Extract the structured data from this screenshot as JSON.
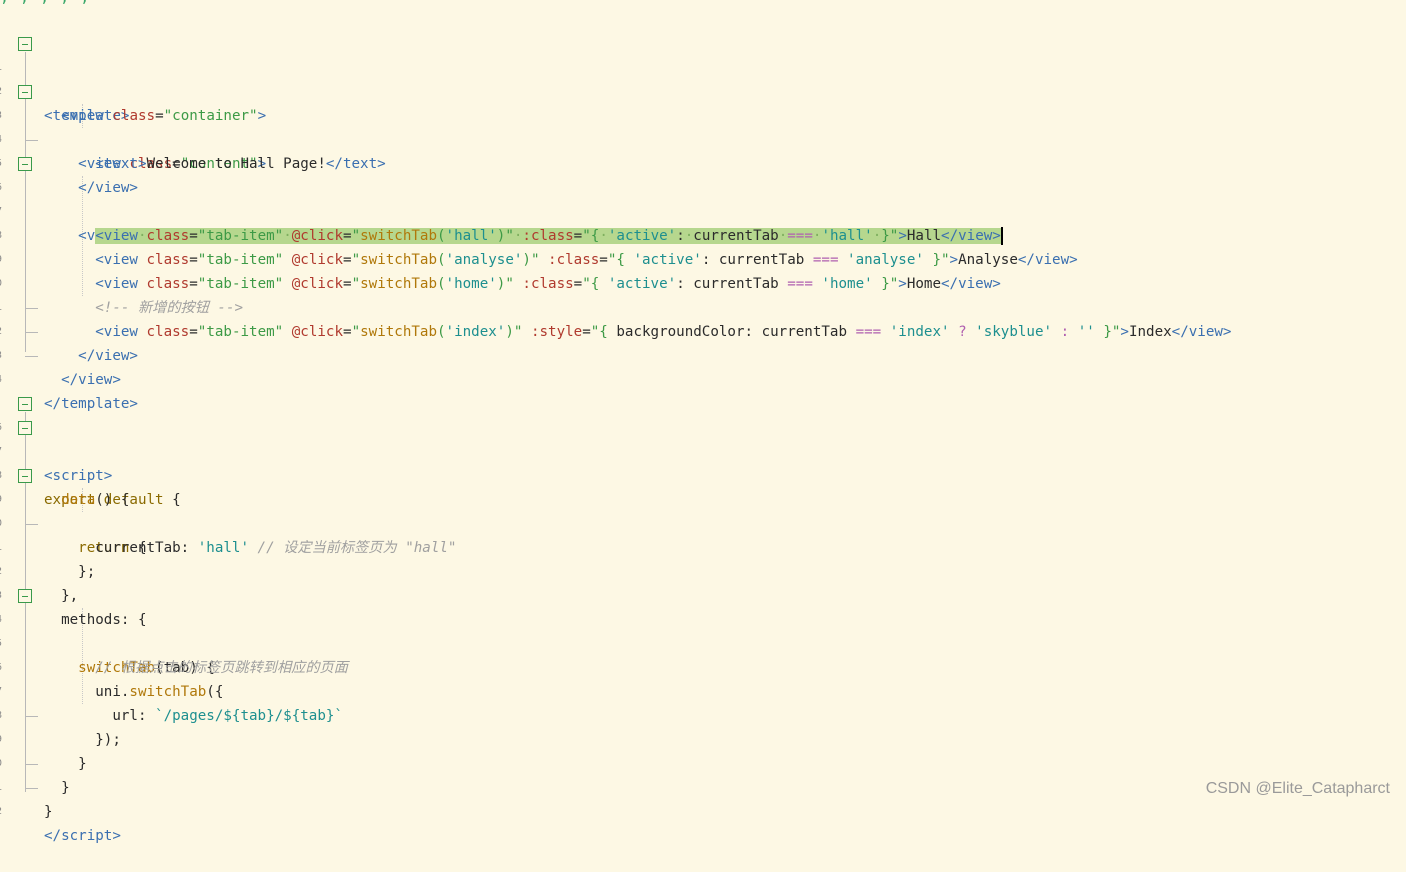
{
  "top_strip_text": "               ,                                 ,            ,                                          ,                                                                          ,",
  "gutter_numbers": [
    "1",
    "2",
    "3",
    "4",
    "5",
    "6",
    "7",
    "8",
    "9",
    "0",
    "1",
    "2",
    "3",
    "4",
    "",
    "6",
    "7",
    "8",
    "9",
    "0",
    "1",
    "2",
    "3",
    "4",
    "5",
    "6",
    "7",
    "8",
    "9",
    "0",
    "1",
    "2"
  ],
  "code": {
    "template_open": "<template>",
    "view_container": "container",
    "view_content": "content",
    "text_content": "Welcome to Hall Page!",
    "view_tabbar": "tab-bar",
    "tab_item_class": "tab-item",
    "tabs": [
      {
        "arg": "'hall'",
        "cmp": "'hall'",
        "label": "Hall"
      },
      {
        "arg": "'analyse'",
        "cmp": "'analyse'",
        "label": "Analyse"
      },
      {
        "arg": "'home'",
        "cmp": "'home'",
        "label": "Home"
      }
    ],
    "comment_new_button": "<!-- 新增的按钮 -->",
    "index_tab": {
      "arg": "'index'",
      "cmp": "'index'",
      "color": "'skyblue'",
      "empty": "''",
      "label": "Index"
    },
    "current_tab_value": "'hall'",
    "current_tab_comment": "// 设定当前标签页为 \"hall\"",
    "switch_comment": "// 根据点击的标签页跳转到相应的页面",
    "url_template": "`/pages/${tab}/${tab}`"
  },
  "watermark": "CSDN @Elite_Catapharct"
}
